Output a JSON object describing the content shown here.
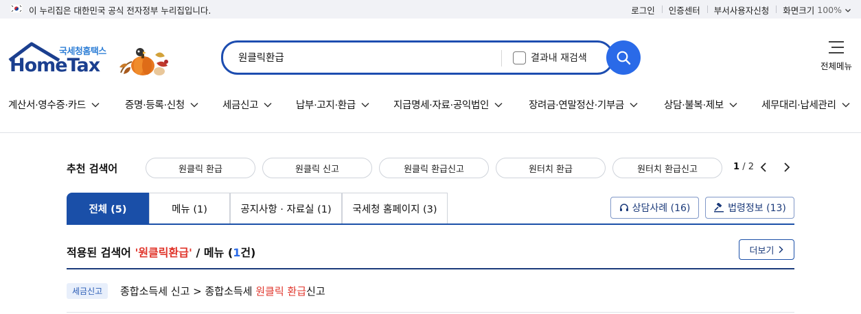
{
  "topbar": {
    "gov_notice": "이 누리집은 대한민국 공식 전자정부 누리집입니다.",
    "links": [
      "로그인",
      "인증센터",
      "부서사용자신청",
      "화면크기"
    ],
    "font_size": "100%"
  },
  "logo": {
    "sub": "국세청홈택스",
    "main": "HomeTax"
  },
  "search": {
    "query": "원클릭환급",
    "recheck_label": "결과내 재검색"
  },
  "all_menu_label": "전체메뉴",
  "gnb": [
    "계산서·영수증·카드",
    "증명·등록·신청",
    "세금신고",
    "납부·고지·환급",
    "지급명세·자료·공익법인",
    "장려금·연말정산·기부금",
    "상담·불복·제보",
    "세무대리·납세관리"
  ],
  "recommend": {
    "label": "추천 검색어",
    "chips": [
      "원클릭 환급",
      "원클릭 신고",
      "원클릭 환급신고",
      "원터치 환급",
      "원터치 환급신고"
    ],
    "page_current": "1",
    "page_total": "/ 2"
  },
  "tabs": [
    "전체 (5)",
    "메뉴 (1)",
    "공지사항 · 자료실 (1)",
    "국세청 홈페이지 (3)"
  ],
  "side_buttons": [
    "상담사례 (16)",
    "법령정보 (13)"
  ],
  "result": {
    "prefix": "적용된 검색어 ",
    "keyword": "'원클릭환급'",
    "middle": " / 메뉴 (",
    "count": "1",
    "suffix": "건)",
    "more_label": "더보기"
  },
  "items": [
    {
      "badge": "세금신고",
      "path_prefix": "종합소득세 신고 > 종합소득세 ",
      "path_keyword": "원클릭 환급",
      "path_suffix": "신고"
    }
  ],
  "colors": {
    "primary": "#1a4fa8",
    "accent": "#2a6ae8",
    "keyword": "#e0352b"
  }
}
